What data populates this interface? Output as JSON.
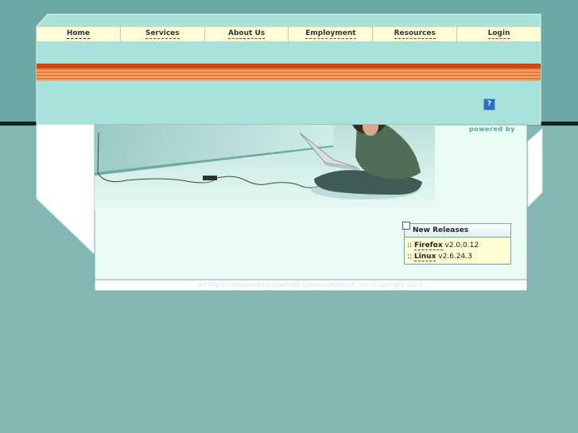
{
  "nav": {
    "items": [
      "Home",
      "Services",
      "About Us",
      "Employment",
      "Resources",
      "Login"
    ]
  },
  "help_icon": "?",
  "powered_by": "powered by",
  "new_releases": {
    "title": "New Releases",
    "items": [
      {
        "prefix": "::",
        "name": "Firefox",
        "version": "v2.0.0.12"
      },
      {
        "prefix": "::",
        "name": "Linux",
        "version": "v2.6.24.3"
      }
    ]
  },
  "footer": {
    "text": "All Rights Reserved by Qualhost Communications, Inc. Copyright 2002"
  },
  "colors": {
    "background": "#84b6b4",
    "panel": "#a9e2dd",
    "content": "#e8fcf4",
    "nav_bar": "#fffdd8",
    "stripe": "#c84b16",
    "link_underline": "#b03020"
  }
}
